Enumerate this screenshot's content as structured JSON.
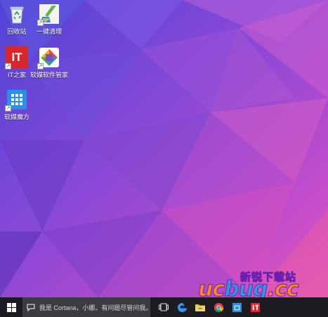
{
  "desktop": {
    "icons": [
      {
        "label": "回收站",
        "icon": "recycle-bin-icon"
      },
      {
        "label": "一键清理",
        "icon": "broom-cleanup-icon"
      },
      {
        "label": "IT之家",
        "icon": "ithome-icon",
        "text": "IT"
      },
      {
        "label": "软媒软件管家",
        "icon": "software-manager-icon"
      },
      {
        "label": "软媒魔方",
        "icon": "cube-icon"
      }
    ]
  },
  "taskbar": {
    "cortana_placeholder": "我是 Cortana，小娜。有问题尽管问我。",
    "apps": [
      "task-view-icon",
      "edge-icon",
      "file-explorer-icon",
      "chrome-icon",
      "store-icon",
      "ithome-taskbar-icon"
    ]
  },
  "watermark": {
    "top_text": "新锐下载站",
    "logo_text": "ucbug.cc"
  },
  "colors": {
    "taskbar": "#1c1c22",
    "cortana_box": "#3b3b42",
    "wallpaper_purple": "#6a3fc8",
    "wallpaper_pink": "#e04fbf"
  }
}
